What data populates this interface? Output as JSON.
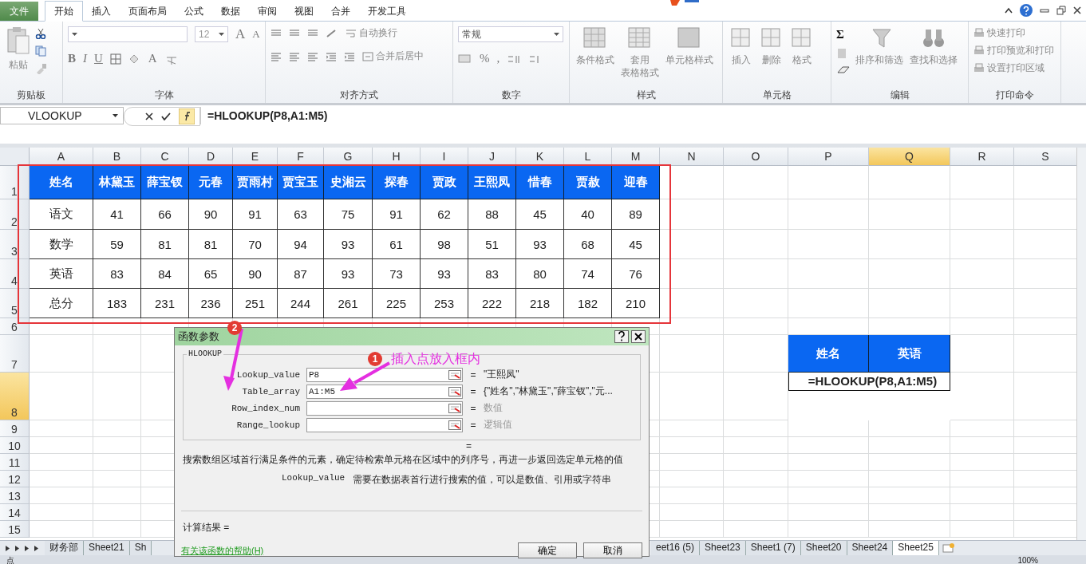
{
  "menu_tabs": [
    {
      "label": "文件",
      "kind": "file",
      "selected": false
    },
    {
      "label": "开始",
      "kind": "tab",
      "selected": true
    },
    {
      "label": "插入",
      "kind": "tab",
      "selected": false
    },
    {
      "label": "页面布局",
      "kind": "tab",
      "selected": false
    },
    {
      "label": "公式",
      "kind": "tab",
      "selected": false
    },
    {
      "label": "数据",
      "kind": "tab",
      "selected": false
    },
    {
      "label": "审阅",
      "kind": "tab",
      "selected": false
    },
    {
      "label": "视图",
      "kind": "tab",
      "selected": false
    },
    {
      "label": "合并",
      "kind": "tab",
      "selected": false
    },
    {
      "label": "开发工具",
      "kind": "tab",
      "selected": false
    }
  ],
  "ribbon": {
    "groups": [
      {
        "kind": "clipboard",
        "title": "剪贴板",
        "labels": [
          "粘贴"
        ]
      },
      {
        "kind": "font",
        "title": "字体",
        "labels": [
          "12",
          "A",
          "A",
          "B",
          "I",
          "U",
          "A"
        ]
      },
      {
        "kind": "alignment",
        "title": "对齐方式",
        "labels": [
          "自动换行",
          "合并后居中"
        ]
      },
      {
        "kind": "number",
        "title": "数字",
        "labels": [
          "常规",
          "%",
          ","
        ]
      },
      {
        "kind": "styles",
        "title": "样式",
        "labels": [
          "条件格式",
          "套用",
          "表格格式",
          "单元格样式"
        ]
      },
      {
        "kind": "cells",
        "title": "单元格",
        "labels": [
          "插入",
          "删除",
          "格式"
        ]
      },
      {
        "kind": "editing",
        "title": "编辑",
        "labels": [
          "Σ",
          "排序和筛选",
          "查找和选择"
        ]
      },
      {
        "kind": "print",
        "title": "打印命令",
        "labels": [
          "快速打印",
          "打印预览和打印",
          "设置打印区域"
        ]
      }
    ]
  },
  "formula_bar": {
    "name_box": "VLOOKUP",
    "formula": "=HLOOKUP(P8,A1:M5)"
  },
  "columns": [
    {
      "label": "A",
      "selected": false
    },
    {
      "label": "B",
      "selected": false
    },
    {
      "label": "C",
      "selected": false
    },
    {
      "label": "D",
      "selected": false
    },
    {
      "label": "E",
      "selected": false
    },
    {
      "label": "F",
      "selected": false
    },
    {
      "label": "G",
      "selected": false
    },
    {
      "label": "H",
      "selected": false
    },
    {
      "label": "I",
      "selected": false
    },
    {
      "label": "J",
      "selected": false
    },
    {
      "label": "K",
      "selected": false
    },
    {
      "label": "L",
      "selected": false
    },
    {
      "label": "M",
      "selected": false
    },
    {
      "label": "N",
      "selected": false
    },
    {
      "label": "O",
      "selected": false
    },
    {
      "label": "P",
      "selected": false
    },
    {
      "label": "Q",
      "selected": true
    },
    {
      "label": "R",
      "selected": false
    },
    {
      "label": "S",
      "selected": false
    }
  ],
  "rows": [
    {
      "label": "1",
      "selected": false
    },
    {
      "label": "2",
      "selected": false
    },
    {
      "label": "3",
      "selected": false
    },
    {
      "label": "4",
      "selected": false
    },
    {
      "label": "5",
      "selected": false
    },
    {
      "label": "6",
      "selected": false
    },
    {
      "label": "7",
      "selected": false
    },
    {
      "label": "8",
      "selected": true
    },
    {
      "label": "9",
      "selected": false
    },
    {
      "label": "10",
      "selected": false
    },
    {
      "label": "11",
      "selected": false
    },
    {
      "label": "12",
      "selected": false
    },
    {
      "label": "13",
      "selected": false
    },
    {
      "label": "14",
      "selected": false
    },
    {
      "label": "15",
      "selected": false
    }
  ],
  "table": {
    "header": [
      "姓名",
      "林黛玉",
      "薛宝钗",
      "元春",
      "贾雨村",
      "贾宝玉",
      "史湘云",
      "探春",
      "贾政",
      "王熙凤",
      "惜春",
      "贾赦",
      "迎春"
    ],
    "rows": [
      [
        "语文",
        "41",
        "66",
        "90",
        "91",
        "63",
        "75",
        "91",
        "62",
        "88",
        "45",
        "40",
        "89"
      ],
      [
        "数学",
        "59",
        "81",
        "81",
        "70",
        "94",
        "93",
        "61",
        "98",
        "51",
        "93",
        "68",
        "45"
      ],
      [
        "英语",
        "83",
        "84",
        "65",
        "90",
        "87",
        "93",
        "73",
        "93",
        "83",
        "80",
        "74",
        "76"
      ],
      [
        "总分",
        "183",
        "231",
        "236",
        "251",
        "244",
        "261",
        "225",
        "253",
        "222",
        "218",
        "182",
        "210"
      ]
    ]
  },
  "lookup": {
    "headers": [
      "姓名",
      "英语"
    ],
    "formula": "=HLOOKUP(P8,A1:M5)"
  },
  "dialog": {
    "title": "函数参数",
    "function": "HLOOKUP",
    "params": [
      {
        "name": "Lookup_value",
        "value": "P8",
        "result": "\"王熙凤\"",
        "kind": "value"
      },
      {
        "name": "Table_array",
        "value": "A1:M5",
        "result": "{\"姓名\",\"林黛玉\",\"薛宝钗\",\"元...",
        "kind": "value"
      },
      {
        "name": "Row_index_num",
        "result": "数值",
        "kind": "hint"
      },
      {
        "name": "Range_lookup",
        "result": "逻辑值",
        "kind": "hint"
      }
    ],
    "equals": "=",
    "description": "搜索数组区域首行满足条件的元素，确定待检索单元格在区域中的列序号，再进一步返回选定单元格的值",
    "param_name": "Lookup_value",
    "param_help": "需要在数据表首行进行搜索的值，可以是数值、引用或字符串",
    "result_label": "计算结果 =",
    "help_link": "有关该函数的帮助(H)",
    "buttons": [
      "确定",
      "取消"
    ]
  },
  "annotations": {
    "badges": [
      "2",
      "1"
    ],
    "note": "插入点放入框内"
  },
  "sheet_tabs": [
    {
      "label": "财务部",
      "selected": false
    },
    {
      "label": "Sheet21",
      "selected": false
    },
    {
      "label": "Sh",
      "selected": false
    },
    {
      "label": "eet16 (5)",
      "selected": false
    },
    {
      "label": "Sheet23",
      "selected": false
    },
    {
      "label": "Sheet1 (7)",
      "selected": false
    },
    {
      "label": "Sheet20",
      "selected": false
    },
    {
      "label": "Sheet24",
      "selected": false
    },
    {
      "label": "Sheet25",
      "selected": true
    }
  ],
  "status_bar": {
    "left": "点",
    "zoom": "100%"
  }
}
